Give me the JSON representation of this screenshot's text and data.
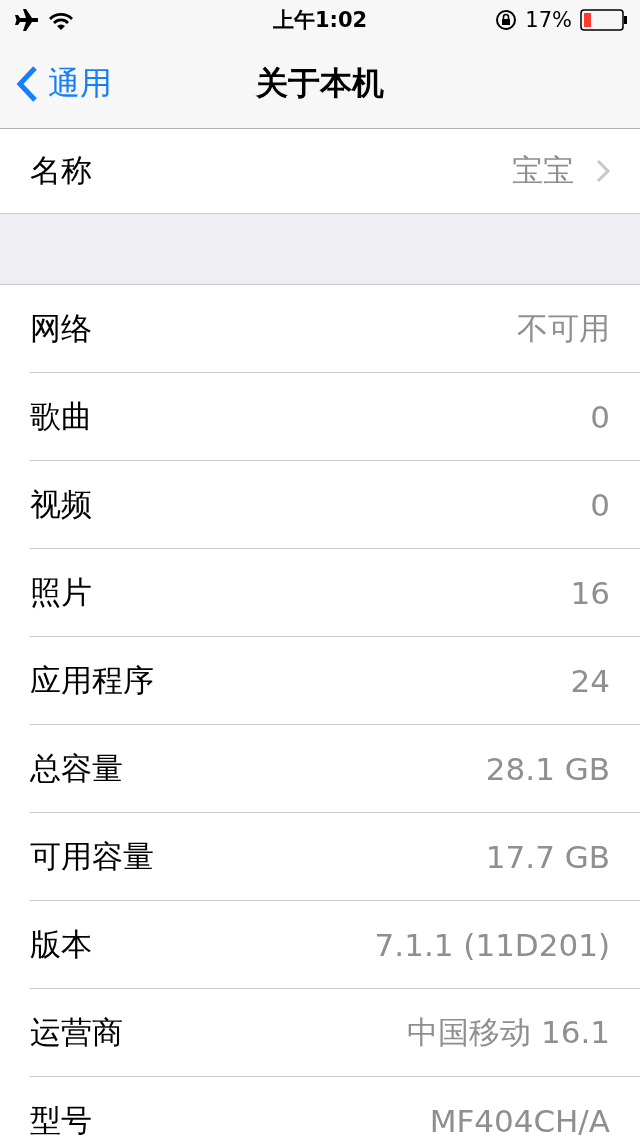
{
  "status_bar": {
    "time": "上午1:02",
    "battery_percent": "17%"
  },
  "nav": {
    "back_label": "通用",
    "title": "关于本机"
  },
  "name_row": {
    "label": "名称",
    "value": "宝宝"
  },
  "info_rows": [
    {
      "label": "网络",
      "value": "不可用"
    },
    {
      "label": "歌曲",
      "value": "0"
    },
    {
      "label": "视频",
      "value": "0"
    },
    {
      "label": "照片",
      "value": "16"
    },
    {
      "label": "应用程序",
      "value": "24"
    },
    {
      "label": "总容量",
      "value": "28.1 GB"
    },
    {
      "label": "可用容量",
      "value": "17.7 GB"
    },
    {
      "label": "版本",
      "value": "7.1.1 (11D201)"
    },
    {
      "label": "运营商",
      "value": "中国移动 16.1"
    },
    {
      "label": "型号",
      "value": "MF404CH/A"
    }
  ]
}
